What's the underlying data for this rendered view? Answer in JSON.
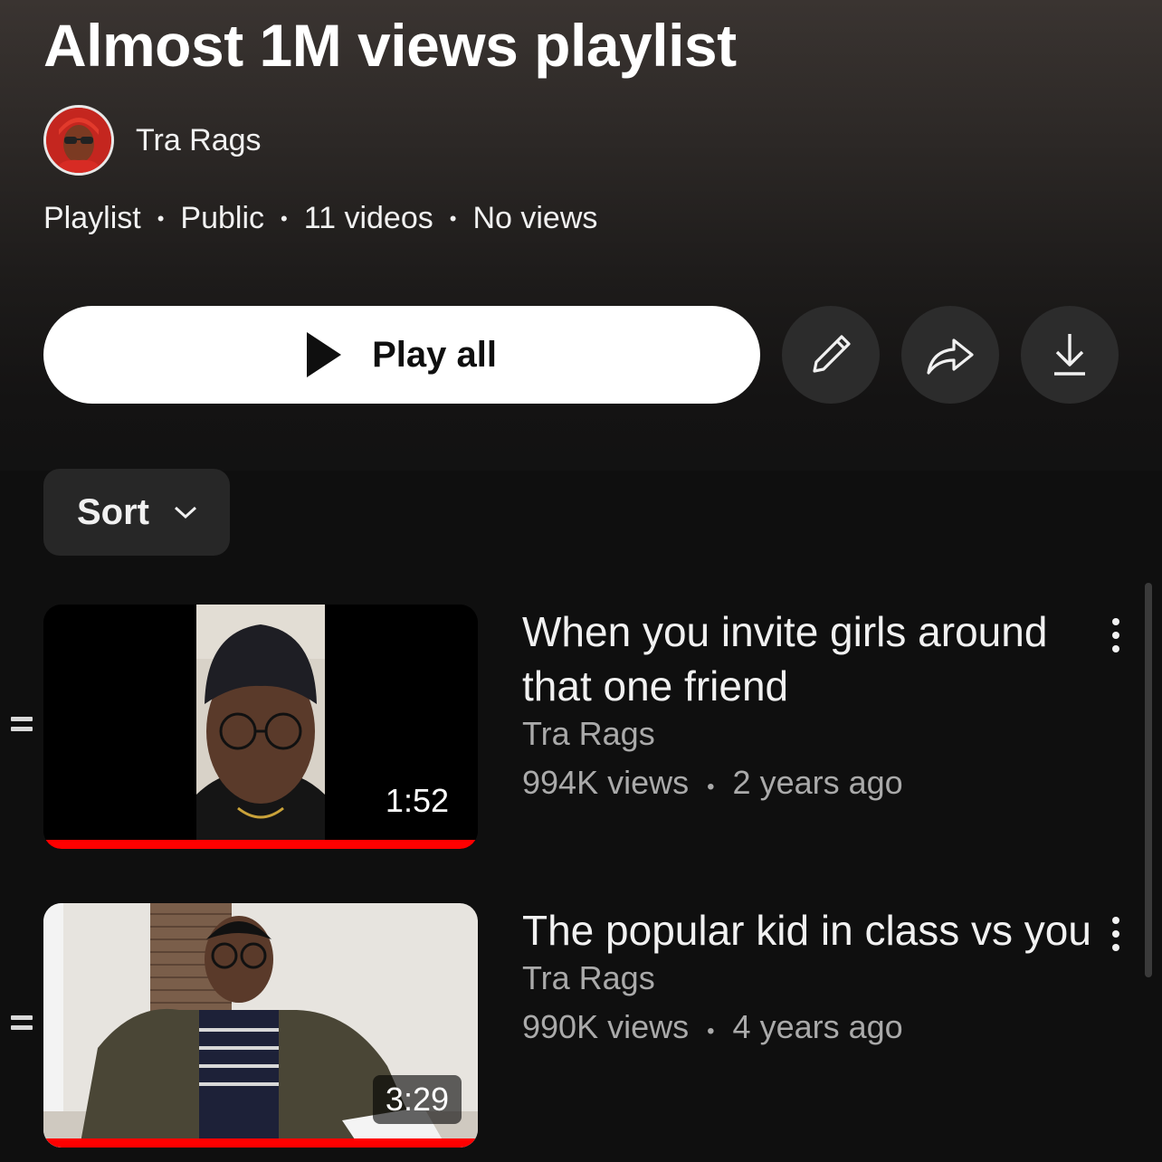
{
  "playlist": {
    "title": "Almost 1M views playlist",
    "owner": "Tra Rags",
    "meta": [
      "Playlist",
      "Public",
      "11 videos",
      "No views"
    ],
    "meta_separator": "•"
  },
  "actions": {
    "play_all_label": "Play all",
    "edit_icon": "pencil-icon",
    "share_icon": "share-arrow-icon",
    "download_icon": "download-icon"
  },
  "sort": {
    "label": "Sort",
    "icon": "chevron-down-icon"
  },
  "videos": [
    {
      "title": "When you invite girls around that one friend",
      "channel": "Tra Rags",
      "views": "994K views",
      "separator": "•",
      "age": "2 years ago",
      "duration": "1:52",
      "watched_progress": 1.0
    },
    {
      "title": "The popular kid in class vs you",
      "channel": "Tra Rags",
      "views": "990K views",
      "separator": "•",
      "age": "4 years ago",
      "duration": "3:29",
      "watched_progress": 1.0
    }
  ],
  "colors": {
    "background": "#0f0f0f",
    "progress": "#ff0000",
    "button_light": "#ffffff",
    "button_dark": "#2c2c2c",
    "secondary_text": "#aaaaaa"
  }
}
